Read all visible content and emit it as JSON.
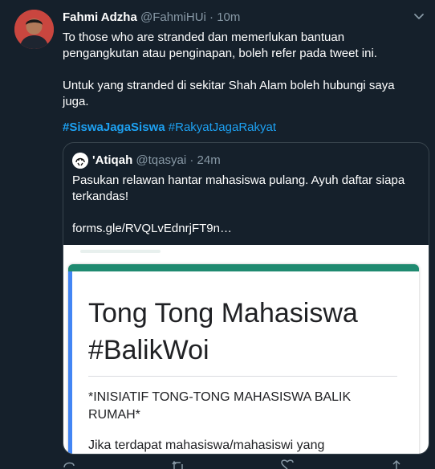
{
  "tweet": {
    "name": "Fahmi Adzha",
    "handle": "@FahmiHUi",
    "separator": "·",
    "time": "10m",
    "body_line1": "To those who are stranded dan memerlukan bantuan pengangkutan atau penginapan, boleh refer pada tweet ini.",
    "body_line2": "Untuk yang stranded di sekitar Shah Alam boleh hubungi saya juga.",
    "hashtag1": "#SiswaJagaSiswa",
    "hashtag2": "#RakyatJagaRakyat"
  },
  "quote": {
    "name": "'Atiqah",
    "handle": "@tqasyai",
    "separator": "·",
    "time": "24m",
    "text": "Pasukan relawan hantar mahasiswa pulang. Ayuh daftar siapa terkandas!",
    "link": "forms.gle/RVQLvEdnrjFT9n…",
    "card": {
      "title_line1": "Tong Tong Mahasiswa",
      "title_line2": "#BalikWoi",
      "description": "*INISIATIF TONG-TONG MAHASISWA BALIK RUMAH*",
      "description2": "Jika terdapat mahasiswa/mahasiswi yang"
    }
  },
  "icons": [
    "caret-down-icon",
    "reply-icon",
    "retweet-icon",
    "like-icon",
    "share-icon"
  ],
  "colors": {
    "background": "#15202b",
    "accent": "#1da1f2",
    "secondary_text": "#8899a6",
    "border": "#38444d",
    "form_green": "#1f8a70",
    "form_blue": "#4285f4"
  }
}
